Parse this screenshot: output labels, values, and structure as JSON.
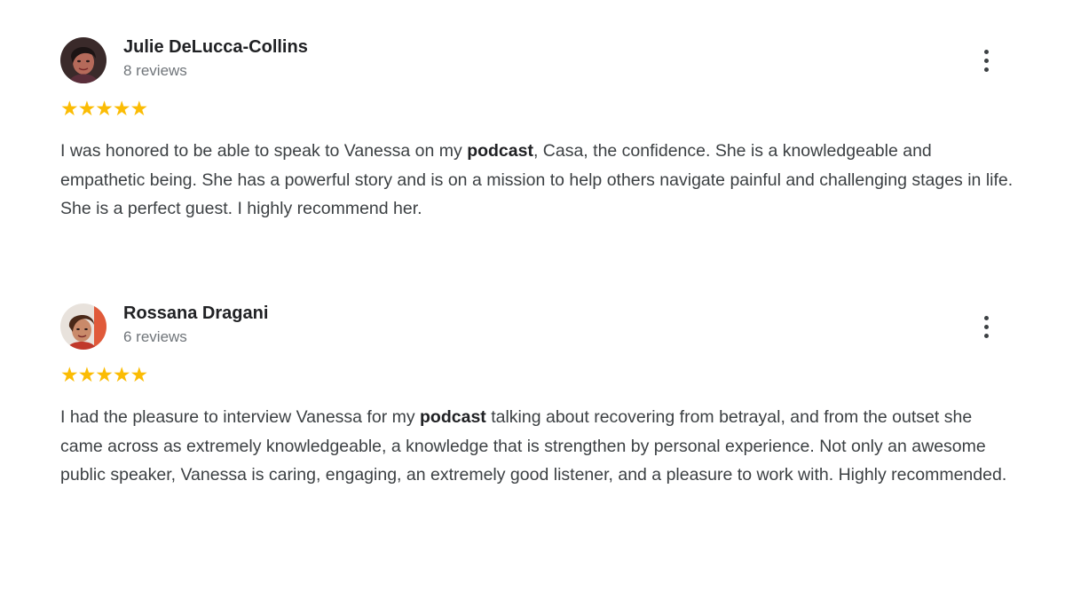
{
  "reviews": [
    {
      "author": "Julie DeLucca-Collins",
      "review_count": "8 reviews",
      "rating": 5,
      "text_parts": [
        "I was honored to be able to speak to Vanessa on my ",
        "podcast",
        ", Casa, the confidence. She is a knowledgeable and empathetic being. She has a powerful story and is on a mission to help others navigate painful and challenging stages in life. She is a perfect guest. I highly recommend her."
      ],
      "avatar_icon": "profile-photo-icon"
    },
    {
      "author": "Rossana Dragani",
      "review_count": "6 reviews",
      "rating": 5,
      "text_parts": [
        "I had the pleasure to interview Vanessa for my ",
        "podcast",
        " talking about recovering from betrayal, and from the outset she came across as extremely knowledgeable, a knowledge that is strengthen by personal experience. Not only an awesome public speaker, Vanessa is caring, engaging, an extremely good listener, and a pleasure to work with. Highly recommended."
      ],
      "avatar_icon": "profile-photo-icon"
    }
  ],
  "colors": {
    "star": "#fbbc04",
    "name": "#202124",
    "meta": "#70757a",
    "body": "#3c4043"
  },
  "icons": {
    "star": "star-icon",
    "more": "more-vert-icon"
  }
}
